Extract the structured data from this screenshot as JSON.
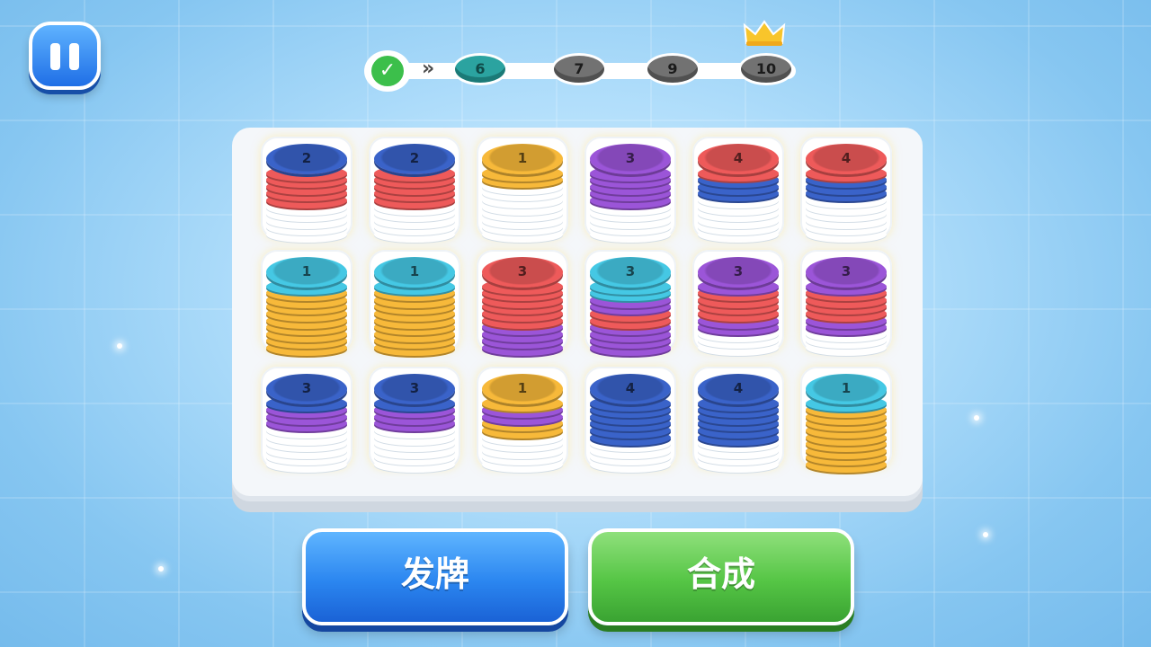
{
  "progress": {
    "completed_icon": "check-icon",
    "arrow": "»",
    "levels": [
      "6",
      "7",
      "9",
      "10"
    ],
    "current_level": "6",
    "goal_icon": "crown-icon"
  },
  "colors": {
    "1": "#f7b93a",
    "2": "#ee5a5a",
    "3": "#9b55d8",
    "4": "#3a63c9",
    "cyan": "#45c8e4",
    "empty": "#f2f6f8"
  },
  "board": {
    "slots": [
      {
        "stack": [
          "4",
          "2",
          "2",
          "2",
          "2",
          "2"
        ],
        "label": "2"
      },
      {
        "stack": [
          "4",
          "2",
          "2",
          "2",
          "2",
          "2"
        ],
        "label": "2"
      },
      {
        "stack": [
          "1",
          "1",
          "1"
        ],
        "label": "1"
      },
      {
        "stack": [
          "3",
          "3",
          "3",
          "3",
          "3",
          "3"
        ],
        "label": "3"
      },
      {
        "stack": [
          "2",
          "2",
          "4",
          "4",
          "4"
        ],
        "label": "4"
      },
      {
        "stack": [
          "2",
          "2",
          "4",
          "4",
          "4"
        ],
        "label": "4"
      },
      {
        "stack": [
          "cyan",
          "cyan",
          "1",
          "1",
          "1",
          "1",
          "1",
          "1",
          "1",
          "1",
          "1"
        ],
        "label": "1"
      },
      {
        "stack": [
          "cyan",
          "cyan",
          "1",
          "1",
          "1",
          "1",
          "1",
          "1",
          "1",
          "1",
          "1"
        ],
        "label": "1"
      },
      {
        "stack": [
          "2",
          "2",
          "2",
          "2",
          "2",
          "2",
          "2",
          "3",
          "3",
          "3",
          "3"
        ],
        "label": "3"
      },
      {
        "stack": [
          "cyan",
          "cyan",
          "cyan",
          "3",
          "3",
          "2",
          "2",
          "3",
          "3",
          "3",
          "3"
        ],
        "label": "3"
      },
      {
        "stack": [
          "3",
          "3",
          "2",
          "2",
          "2",
          "2",
          "3",
          "3"
        ],
        "label": "3"
      },
      {
        "stack": [
          "3",
          "3",
          "2",
          "2",
          "2",
          "2",
          "3",
          "3"
        ],
        "label": "3"
      },
      {
        "stack": [
          "4",
          "4",
          "3",
          "3",
          "3"
        ],
        "label": "3"
      },
      {
        "stack": [
          "4",
          "4",
          "3",
          "3",
          "3"
        ],
        "label": "3"
      },
      {
        "stack": [
          "1",
          "1",
          "3",
          "3",
          "1",
          "1"
        ],
        "label": "1"
      },
      {
        "stack": [
          "4",
          "4",
          "4",
          "4",
          "4",
          "4",
          "4"
        ],
        "label": "4"
      },
      {
        "stack": [
          "4",
          "4",
          "4",
          "4",
          "4",
          "4",
          "4"
        ],
        "label": "4"
      },
      {
        "stack": [
          "cyan",
          "cyan",
          "1",
          "1",
          "1",
          "1",
          "1",
          "1",
          "1",
          "1",
          "1"
        ],
        "label": "1"
      }
    ]
  },
  "buttons": {
    "deal_label": "发牌",
    "merge_label": "合成"
  },
  "pause_icon": "pause-icon"
}
